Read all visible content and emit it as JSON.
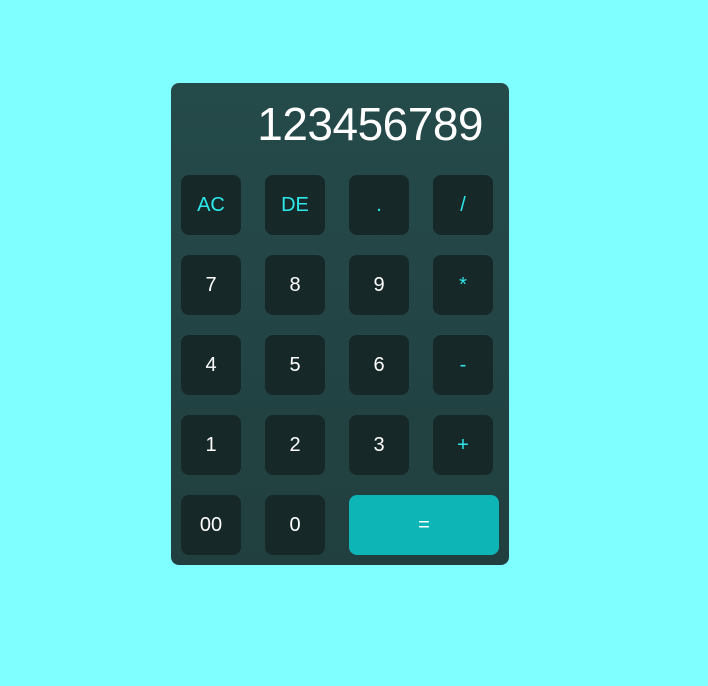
{
  "display": {
    "value": "123456789"
  },
  "buttons": {
    "clear": "AC",
    "delete": "DE",
    "decimal": ".",
    "divide": "/",
    "seven": "7",
    "eight": "8",
    "nine": "9",
    "multiply": "*",
    "four": "4",
    "five": "5",
    "six": "6",
    "subtract": "-",
    "one": "1",
    "two": "2",
    "three": "3",
    "add": "+",
    "double_zero": "00",
    "zero": "0",
    "equals": "="
  },
  "colors": {
    "page_background": "#7fffff",
    "panel": "#234545",
    "key": "#172829",
    "accent_text": "#2de8ea",
    "equals_key": "#0db5b6"
  }
}
